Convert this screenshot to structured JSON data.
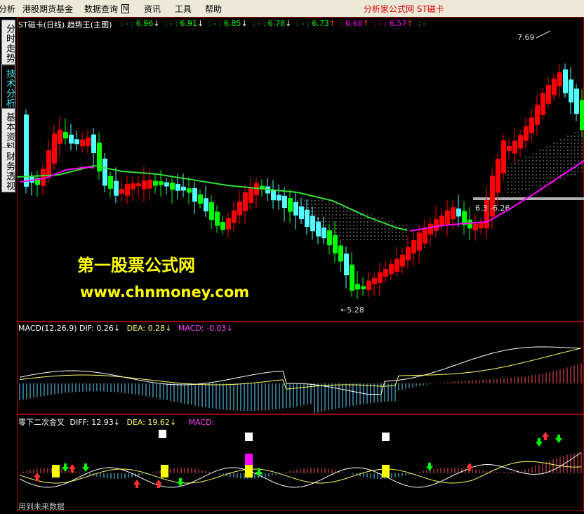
{
  "menu": {
    "items": [
      "分析",
      "港股期货基金",
      "数据查询",
      "资讯",
      "工具",
      "帮助"
    ],
    "shortcut_badge": "N",
    "window_title": "分析家公式网 ST磁卡"
  },
  "sidetabs": [
    "分时走势",
    "技术分析",
    "基本资料",
    "财务透视"
  ],
  "main_panel": {
    "title": "ST磁卡(日线) 趋势王(主图)",
    "values": [
      {
        "text": ": - : 6.96",
        "arrow": "↓",
        "color": "#00ff00"
      },
      {
        "text": ": - : 6.91",
        "arrow": "↓",
        "color": "#00ff00"
      },
      {
        "text": ": - : 6.85",
        "arrow": "↓",
        "color": "#00ff00"
      },
      {
        "text": ": - : 6.78",
        "arrow": "↓",
        "color": "#00ff00"
      },
      {
        "text": ": - : 6.73",
        "arrow": "↑",
        "color": "#00ff00"
      },
      {
        "text": ": 6.68",
        "arrow": "↑",
        "color": "#ff00ff"
      },
      {
        "text": ": - : 6.57",
        "arrow": "↑",
        "color": "#ff00ff"
      },
      {
        "text": ": -",
        "arrow": "",
        "color": "#00ff00"
      }
    ],
    "high_label": "7.69",
    "low_label": "←5.28",
    "mid_label": "6.3 -6.26",
    "watermark_line1": "第一股票公式网",
    "watermark_line2": "www.chnmoney.com"
  },
  "macd_panel": {
    "title": "MACD(12,26,9)",
    "dif": "DIF: 0.26",
    "dif_arrow": "↓",
    "dea": "DEA: 0.28",
    "dea_arrow": "↓",
    "macd": "MACD: -0.03",
    "macd_arrow": "↓"
  },
  "bottom_panel": {
    "title": "零下二次金叉",
    "diff": "DIFF: 12.93",
    "diff_arrow": "↓",
    "dea": "DEA: 19.62",
    "dea_arrow": "↓",
    "macd": "MACD:",
    "footer": "用到未来数据"
  },
  "colors": {
    "up": "#ff0000",
    "down_cyan": "#54ffff",
    "down_green": "#00ff00",
    "ma_green": "#33dd33",
    "ma_magenta": "#ff00ff"
  }
}
